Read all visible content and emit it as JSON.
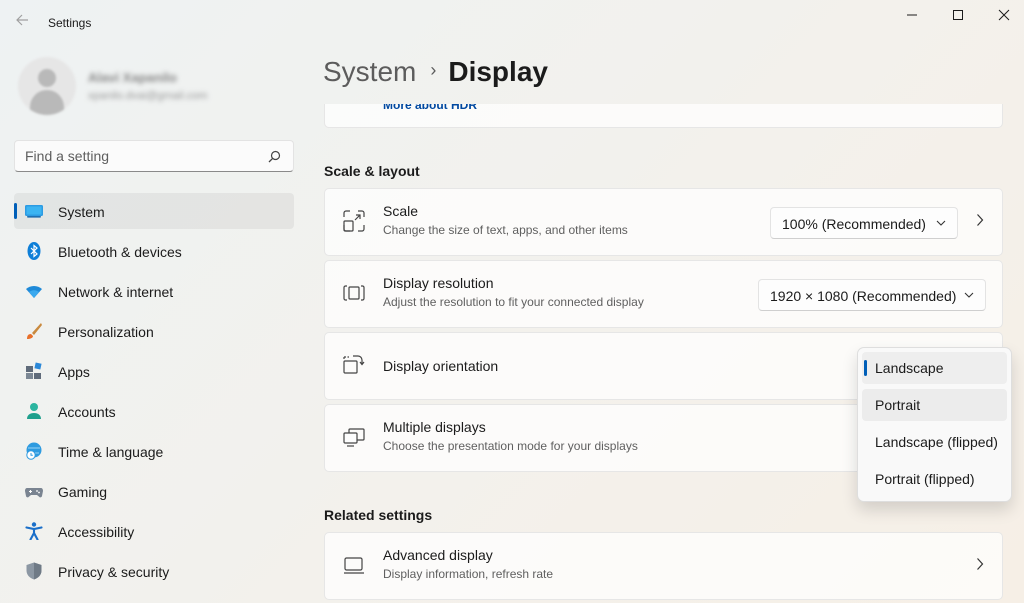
{
  "window": {
    "title": "Settings"
  },
  "profile": {
    "name": "Alavi Xapanilo",
    "email": "xpanilo.dvai@gmail.com"
  },
  "search": {
    "placeholder": "Find a setting"
  },
  "sidebar": {
    "items": [
      {
        "label": "System",
        "icon": "system-icon",
        "active": true
      },
      {
        "label": "Bluetooth & devices",
        "icon": "bluetooth-icon"
      },
      {
        "label": "Network & internet",
        "icon": "wifi-icon"
      },
      {
        "label": "Personalization",
        "icon": "brush-icon"
      },
      {
        "label": "Apps",
        "icon": "apps-icon"
      },
      {
        "label": "Accounts",
        "icon": "person-icon"
      },
      {
        "label": "Time & language",
        "icon": "globe-clock-icon"
      },
      {
        "label": "Gaming",
        "icon": "gamepad-icon"
      },
      {
        "label": "Accessibility",
        "icon": "accessibility-icon"
      },
      {
        "label": "Privacy & security",
        "icon": "shield-icon"
      }
    ]
  },
  "breadcrumb": {
    "parent": "System",
    "separator": "›",
    "current": "Display"
  },
  "hdr": {
    "link": "More about HDR"
  },
  "scale_layout": {
    "title": "Scale & layout",
    "scale": {
      "title": "Scale",
      "subtitle": "Change the size of text, apps, and other items",
      "value": "100% (Recommended)"
    },
    "resolution": {
      "title": "Display resolution",
      "subtitle": "Adjust the resolution to fit your connected display",
      "value": "1920 × 1080 (Recommended)"
    },
    "orientation": {
      "title": "Display orientation"
    },
    "multiple": {
      "title": "Multiple displays",
      "subtitle": "Choose the presentation mode for your displays"
    }
  },
  "orientation_menu": {
    "options": [
      "Landscape",
      "Portrait",
      "Landscape (flipped)",
      "Portrait (flipped)"
    ],
    "selected": "Landscape"
  },
  "related": {
    "title": "Related settings",
    "advanced": {
      "title": "Advanced display",
      "subtitle": "Display information, refresh rate"
    }
  },
  "colors": {
    "accent": "#005fb8",
    "link": "#0048a0"
  }
}
